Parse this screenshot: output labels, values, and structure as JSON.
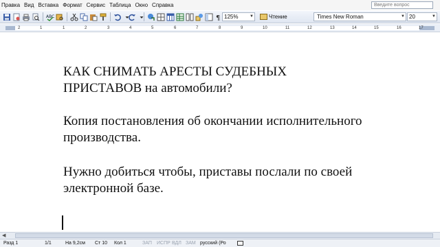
{
  "menu": {
    "items": [
      "Правка",
      "Вид",
      "Вставка",
      "Формат",
      "Сервис",
      "Таблица",
      "Окно",
      "Справка"
    ],
    "ask_placeholder": "Введите вопрос"
  },
  "toolbar": {
    "zoom": "125%",
    "reading_label": "Чтение",
    "font_name": "Times New Roman",
    "font_size": "20",
    "icons": [
      "save-icon",
      "permission-icon",
      "print-icon",
      "print-preview-icon",
      "spelling-icon",
      "research-icon",
      "cut-icon",
      "copy-icon",
      "paste-icon",
      "format-painter-icon",
      "undo-icon",
      "redo-icon",
      "hyperlink-icon",
      "tables-borders-icon",
      "insert-table-icon",
      "insert-excel-icon",
      "columns-icon",
      "drawing-icon",
      "document-map-icon",
      "show-hide-icon"
    ]
  },
  "ruler": {
    "numbers": [
      "2",
      "1",
      "1",
      "2",
      "3",
      "4",
      "5",
      "6",
      "7",
      "8",
      "9",
      "10",
      "11",
      "12",
      "13",
      "14",
      "15",
      "16",
      "17"
    ]
  },
  "document": {
    "paragraphs": [
      [
        "КАК СНИМАТЬ АРЕСТЫ СУДЕБНЫХ",
        "ПРИСТАВОВ на автомобили?"
      ],
      [
        "Копия постановления об окончании исполнительного",
        "производства."
      ],
      [
        "Нужно добиться чтобы, приставы послали по своей",
        "электронной базе."
      ]
    ]
  },
  "status": {
    "section": "Разд 1",
    "page": "1/1",
    "at": "На 9,2см",
    "line": "Ст 10",
    "col": "Кол 1",
    "rec": "ЗАП",
    "trk": "ИСПР",
    "ext": "ВДЛ",
    "ovr": "ЗАМ",
    "language": "русский (Ро"
  }
}
